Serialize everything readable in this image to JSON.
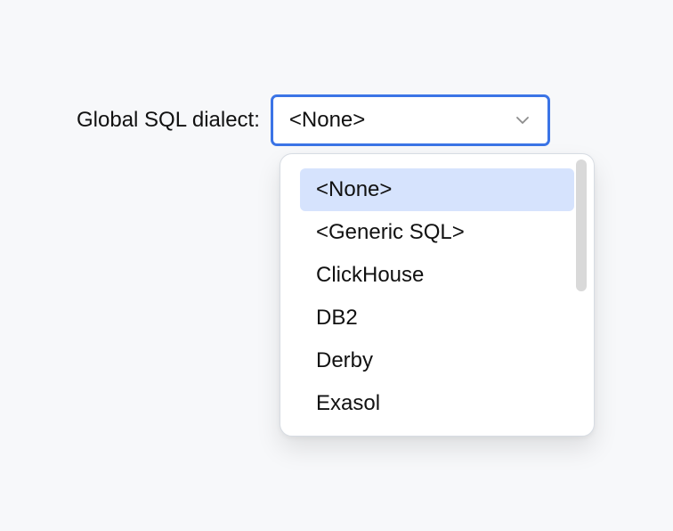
{
  "form": {
    "label": "Global SQL dialect:",
    "selected_value": "<None>"
  },
  "dropdown": {
    "options": [
      {
        "label": "<None>",
        "selected": true
      },
      {
        "label": "<Generic SQL>",
        "selected": false
      },
      {
        "label": "ClickHouse",
        "selected": false
      },
      {
        "label": "DB2",
        "selected": false
      },
      {
        "label": "Derby",
        "selected": false
      },
      {
        "label": "Exasol",
        "selected": false
      }
    ]
  },
  "icons": {
    "select": "chevron-down-icon"
  },
  "colors": {
    "focus_border": "#3b74e6",
    "selected_option": "#d6e3fd",
    "scrollbar_thumb": "#d9d9d9"
  }
}
